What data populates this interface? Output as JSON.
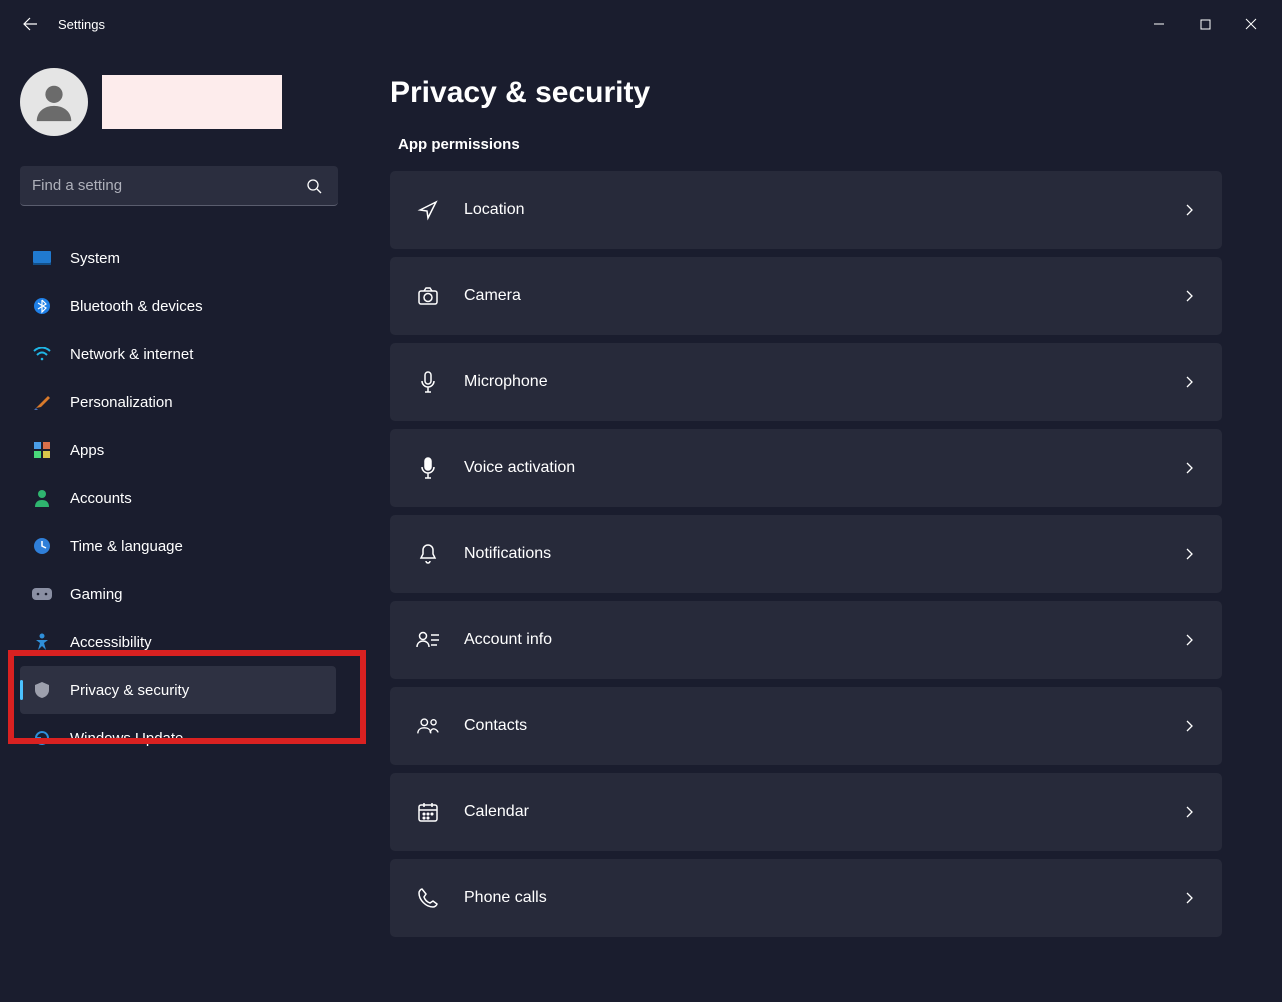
{
  "app_title": "Settings",
  "search_placeholder": "Find a setting",
  "page_title": "Privacy & security",
  "section_title": "App permissions",
  "nav": [
    {
      "key": "system",
      "label": "System"
    },
    {
      "key": "bluetooth",
      "label": "Bluetooth & devices"
    },
    {
      "key": "network",
      "label": "Network & internet"
    },
    {
      "key": "personalization",
      "label": "Personalization"
    },
    {
      "key": "apps",
      "label": "Apps"
    },
    {
      "key": "accounts",
      "label": "Accounts"
    },
    {
      "key": "time",
      "label": "Time & language"
    },
    {
      "key": "gaming",
      "label": "Gaming"
    },
    {
      "key": "accessibility",
      "label": "Accessibility"
    },
    {
      "key": "privacy",
      "label": "Privacy & security"
    },
    {
      "key": "update",
      "label": "Windows Update"
    }
  ],
  "permissions": [
    {
      "key": "location",
      "label": "Location"
    },
    {
      "key": "camera",
      "label": "Camera"
    },
    {
      "key": "microphone",
      "label": "Microphone"
    },
    {
      "key": "voice",
      "label": "Voice activation"
    },
    {
      "key": "notifications",
      "label": "Notifications"
    },
    {
      "key": "account",
      "label": "Account info"
    },
    {
      "key": "contacts",
      "label": "Contacts"
    },
    {
      "key": "calendar",
      "label": "Calendar"
    },
    {
      "key": "phone",
      "label": "Phone calls"
    }
  ],
  "active_nav": "privacy",
  "highlighted_nav": "privacy"
}
